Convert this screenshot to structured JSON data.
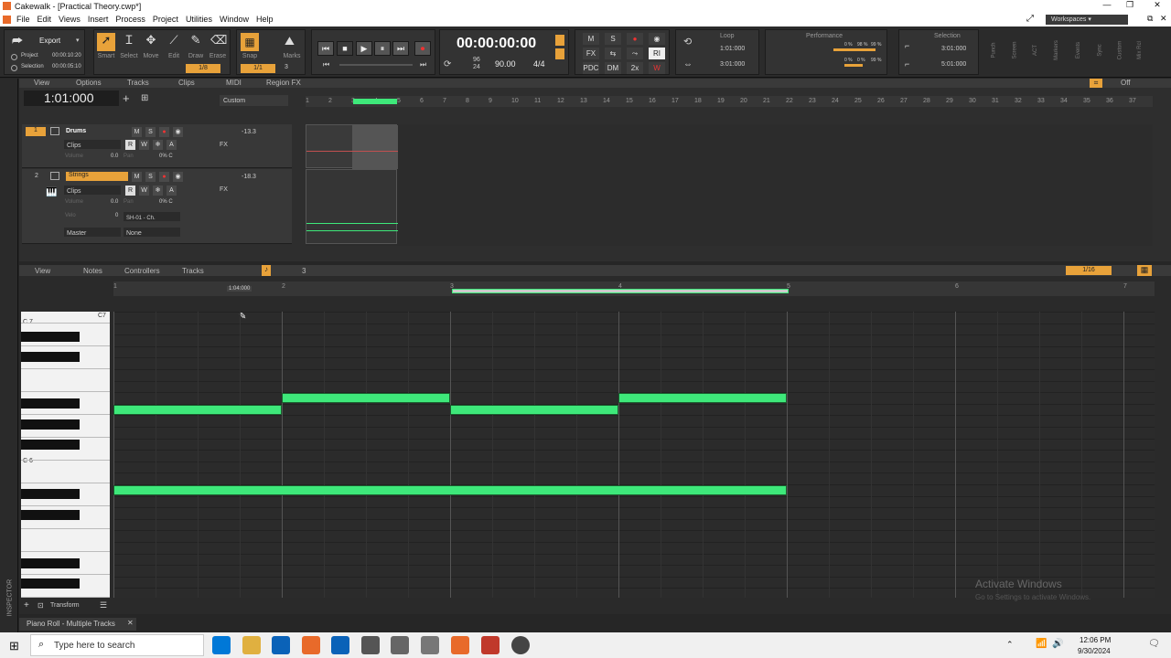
{
  "window": {
    "title": "Cakewalk - [Practical Theory.cwp*]"
  },
  "menu": [
    "File",
    "Edit",
    "Views",
    "Insert",
    "Process",
    "Project",
    "Utilities",
    "Window",
    "Help"
  ],
  "controlbar": {
    "export_label": "Export",
    "project_label": "Project",
    "selection_label": "Selection",
    "project_time": "00:00:10:20",
    "selection_time": "00:00:05:10",
    "tools": [
      "Smart",
      "Select",
      "Move",
      "Edit",
      "Draw",
      "Erase"
    ],
    "snap_label": "Snap",
    "marks_label": "Marks",
    "snap_value": "1/8",
    "snap_value2": "1/1",
    "snap_count": "3",
    "transport_time": "00:00:00:00",
    "tempo": "90.00",
    "meter": "4/4",
    "bpm_top": "96",
    "bpm_bottom": "24",
    "mix_buttons": [
      "M",
      "S",
      "FX",
      "PDC",
      "DM",
      "2x",
      "RI",
      "W"
    ],
    "loop_label": "Loop",
    "loop_start": "1:01:000",
    "loop_end": "3:01:000",
    "performance_label": "Performance",
    "perf_values": [
      "0 %",
      "98 %",
      "99 %",
      "0 %",
      "0 %",
      "99 %"
    ],
    "selection_module_label": "Selection",
    "sel_start": "3:01:000",
    "sel_end": "5:01:000",
    "side_labels": [
      "Punch",
      "Screen",
      "ACT",
      "Markers",
      "Events",
      "Sync",
      "Custom",
      "Mix Rcl"
    ]
  },
  "trackview": {
    "menus": [
      "View",
      "Options",
      "Tracks",
      "Clips",
      "MIDI",
      "Region FX"
    ],
    "now_time": "1:01:000",
    "preset": "Custom",
    "ruler": [
      "1",
      "2",
      "3",
      "4",
      "5",
      "6",
      "7",
      "8",
      "9",
      "10",
      "11",
      "12",
      "13",
      "14",
      "15",
      "16",
      "17",
      "18",
      "19",
      "20",
      "21",
      "22",
      "23",
      "24",
      "25",
      "26",
      "27",
      "28",
      "29",
      "30",
      "31",
      "32",
      "33",
      "34",
      "35",
      "36",
      "37"
    ],
    "tracks": [
      {
        "num": "1",
        "name": "Drums",
        "mode": "Clips",
        "volume_label": "Volume",
        "volume": "0.0",
        "pan_label": "Pan",
        "pan": "0% C",
        "level": "-13.3",
        "fx": "FX"
      },
      {
        "num": "2",
        "name": "Strings",
        "mode": "Clips",
        "volume_label": "Volume",
        "volume": "0.0",
        "pan_label": "Pan",
        "pan": "0% C",
        "level": "-18.3",
        "fx": "FX",
        "vel_label": "Velo",
        "vel": "0",
        "synth": "SH-01 - Ch.",
        "out": "Master",
        "out2": "None"
      }
    ],
    "rec_buttons": [
      "M",
      "S",
      "R",
      "W"
    ],
    "off_label": "Off"
  },
  "pianoroll": {
    "menus": [
      "View",
      "Notes",
      "Controllers",
      "Tracks"
    ],
    "snap": "1/16",
    "count": "3",
    "ruler": [
      "1",
      "2",
      "3",
      "4",
      "5",
      "6",
      "7"
    ],
    "marker_time": "1:04:000",
    "key_c7": "C7",
    "key_c7b": "C 7",
    "key_c6": "C 6",
    "transform": "Transform",
    "tab_title": "Piano Roll - Multiple Tracks",
    "inspector": "INSPECTOR",
    "watermark1": "Activate Windows",
    "watermark2": "Go to Settings to activate Windows."
  },
  "taskbar": {
    "search_placeholder": "Type here to search",
    "time": "12:06 PM",
    "date": "9/30/2024"
  }
}
